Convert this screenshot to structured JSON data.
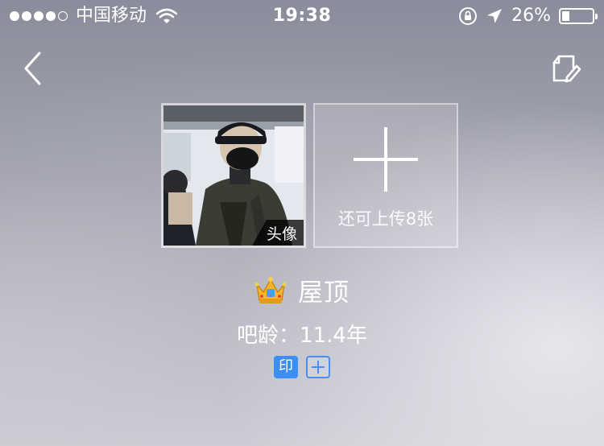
{
  "status_bar": {
    "carrier": "中国移动",
    "time": "19:38",
    "battery_percent": "26%",
    "battery_level": 0.26,
    "signal_bars_filled": 4,
    "signal_bars_total": 5
  },
  "nav": {
    "back_icon": "chevron-left-icon",
    "edit_icon": "edit-note-icon"
  },
  "photos": {
    "avatar_tag": "头像",
    "upload_hint": "还可上传8张"
  },
  "profile": {
    "crown_icon": "crown-icon",
    "name": "屋顶",
    "tieba_age": "吧龄：11.4年",
    "badge_label": "印"
  },
  "colors": {
    "badge_blue": "#3d8ef0",
    "text": "#ffffff"
  }
}
